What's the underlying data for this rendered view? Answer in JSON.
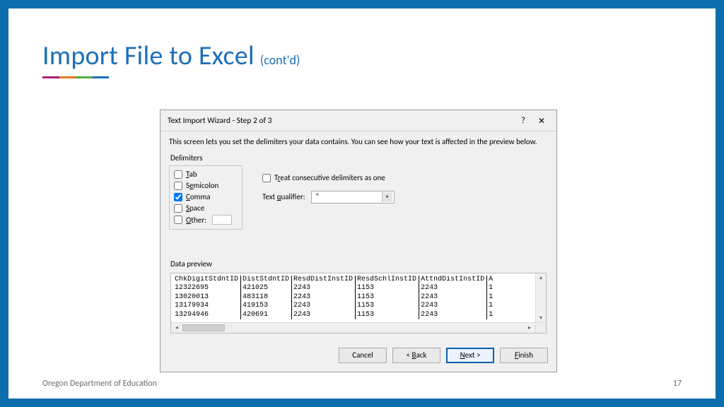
{
  "slide": {
    "title": "Import File to Excel",
    "subtitle": "(cont'd)",
    "footer_org": "Oregon Department of Education",
    "page_number": "17"
  },
  "dialog": {
    "title": "Text Import Wizard - Step 2 of 3",
    "help_symbol": "?",
    "close_symbol": "✕",
    "intro": "This screen lets you set the delimiters your data contains.  You can see how your text is affected in the preview below.",
    "delimiters_label": "Delimiters",
    "options": {
      "tab": {
        "label_pre": "",
        "label_u": "T",
        "label_post": "ab",
        "checked": false
      },
      "semicolon": {
        "label_pre": "S",
        "label_u": "e",
        "label_post": "micolon",
        "checked": false
      },
      "comma": {
        "label_pre": "",
        "label_u": "C",
        "label_post": "omma",
        "checked": true
      },
      "space": {
        "label_pre": "",
        "label_u": "S",
        "label_post": "pace",
        "checked": false
      },
      "other": {
        "label_pre": "",
        "label_u": "O",
        "label_post": "ther:",
        "checked": false,
        "value": ""
      }
    },
    "treat_consecutive": {
      "label_pre": "T",
      "label_u": "r",
      "label_post": "eat consecutive delimiters as one",
      "checked": false
    },
    "text_qualifier": {
      "label_pre": "Text ",
      "label_u": "q",
      "label_post": "ualifier:",
      "value": "\""
    },
    "preview_label": "Data preview",
    "preview": {
      "headers": [
        "ChkDigitStdntID",
        "DistStdntID",
        "ResdDistInstID",
        "ResdSchlInstID",
        "AttndDistInstID",
        "A"
      ],
      "rows": [
        [
          "12322695",
          "421025",
          "2243",
          "1153",
          "2243",
          "1"
        ],
        [
          "13020013",
          "483118",
          "2243",
          "1153",
          "2243",
          "1"
        ],
        [
          "13179934",
          "419153",
          "2243",
          "1153",
          "2243",
          "1"
        ],
        [
          "13294946",
          "420691",
          "2243",
          "1153",
          "2243",
          "1"
        ]
      ]
    },
    "buttons": {
      "cancel": "Cancel",
      "back_pre": "< ",
      "back_u": "B",
      "back_post": "ack",
      "next_u": "N",
      "next_post": "ext >",
      "finish_u": "F",
      "finish_post": "inish"
    }
  }
}
